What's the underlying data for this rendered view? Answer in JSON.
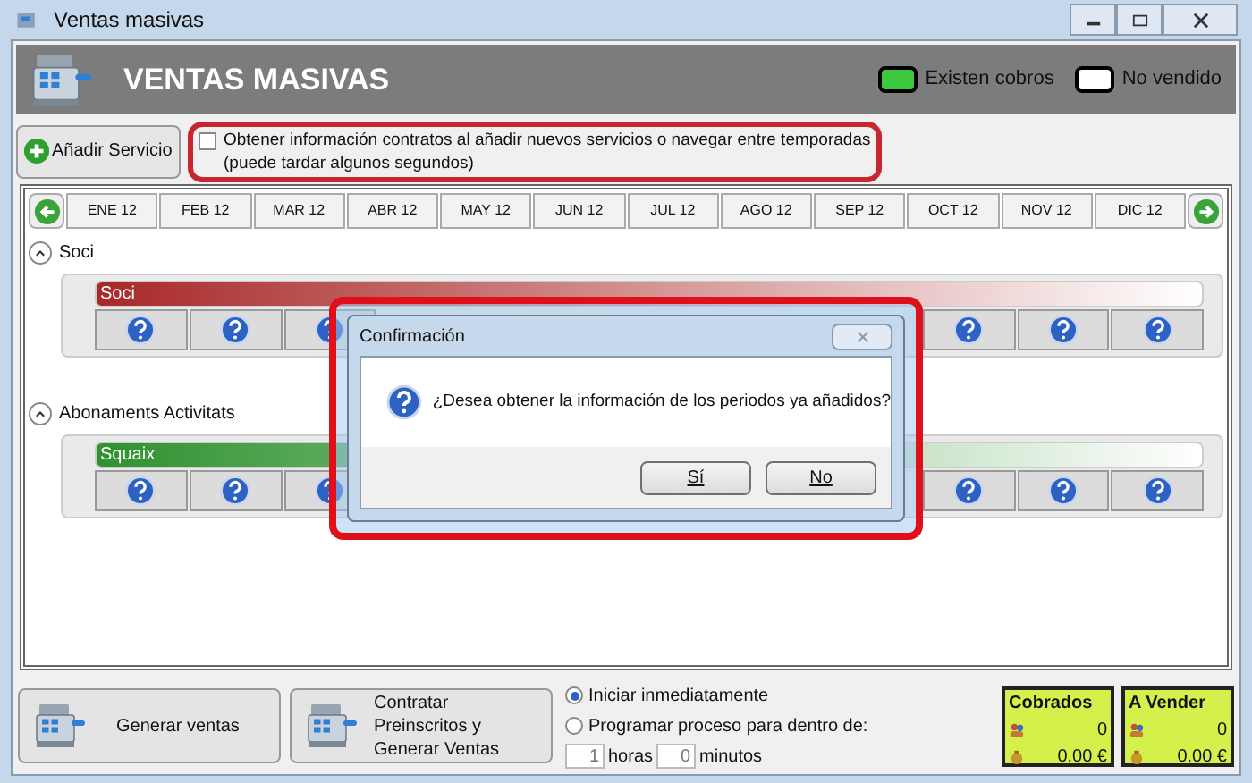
{
  "window": {
    "title": "Ventas masivas"
  },
  "header": {
    "title": "VENTAS MASIVAS",
    "legend": [
      {
        "label": "Existen cobros",
        "color": "#3cc83c"
      },
      {
        "label": "No vendido",
        "color": "#ffffff"
      }
    ]
  },
  "add_button": "Añadir Servicio",
  "option": {
    "label": "Obtener información contratos al añadir nuevos servicios o navegar entre temporadas",
    "note": "(puede tardar algunos segundos)",
    "checked": false
  },
  "months": [
    "ENE 12",
    "FEB 12",
    "MAR 12",
    "ABR 12",
    "MAY 12",
    "JUN 12",
    "JUL 12",
    "AGO 12",
    "SEP 12",
    "OCT 12",
    "NOV 12",
    "DIC 12"
  ],
  "sections": [
    {
      "title": "Soci",
      "expanded": true,
      "bar": {
        "label": "Soci",
        "color": "#a82828"
      }
    },
    {
      "title": "Abonaments Activitats",
      "expanded": true,
      "bar": {
        "label": "Squaix",
        "color": "#2e922e"
      }
    }
  ],
  "dialog": {
    "title": "Confirmación",
    "message": "¿Desea obtener la información de los periodos ya añadidos?",
    "buttons": [
      "Sí",
      "No"
    ]
  },
  "actions": [
    "Generar ventas",
    "Contratar Preinscritos y Generar Ventas"
  ],
  "schedule": [
    {
      "label": "Iniciar inmediatamente",
      "selected": true
    },
    {
      "label": "Programar proceso para dentro de:",
      "selected": false
    }
  ],
  "delay": [
    {
      "value": "1",
      "unit": "horas"
    },
    {
      "value": "0",
      "unit": "minutos"
    }
  ],
  "summaries": [
    {
      "title": "Cobrados",
      "count": "0",
      "amount": "0.00 €"
    },
    {
      "title": "A Vender",
      "count": "0",
      "amount": "0.00 €"
    }
  ]
}
